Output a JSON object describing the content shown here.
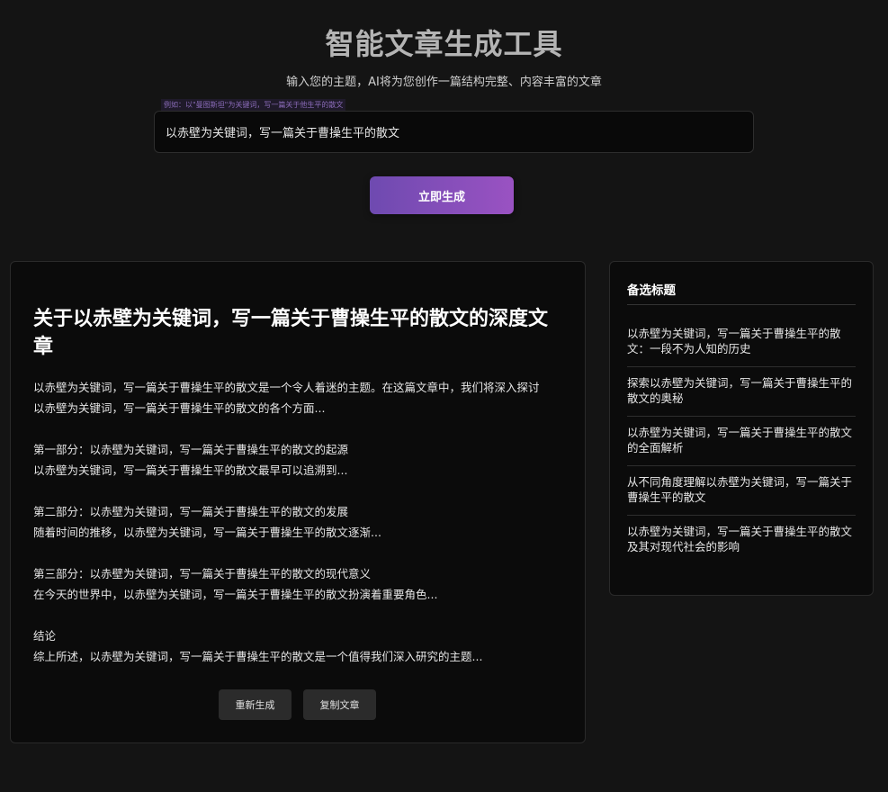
{
  "header": {
    "title": "智能文章生成工具",
    "subtitle": "输入您的主题，AI将为您创作一篇结构完整、内容丰富的文章"
  },
  "form": {
    "hint": "例如：以\"曼图斯坦\"为关键词，写一篇关于他生平的散文",
    "input_value": "以赤壁为关键词，写一篇关于曹操生平的散文",
    "generate_label": "立即生成"
  },
  "article": {
    "title": "关于以赤壁为关键词，写一篇关于曹操生平的散文的深度文章",
    "paragraphs": [
      {
        "line1": "以赤壁为关键词，写一篇关于曹操生平的散文是一个令人着迷的主题。在这篇文章中，我们将深入探讨",
        "line2": "以赤壁为关键词，写一篇关于曹操生平的散文的各个方面..."
      },
      {
        "line1": "第一部分：以赤壁为关键词，写一篇关于曹操生平的散文的起源",
        "line2": "以赤壁为关键词，写一篇关于曹操生平的散文最早可以追溯到..."
      },
      {
        "line1": "第二部分：以赤壁为关键词，写一篇关于曹操生平的散文的发展",
        "line2": "随着时间的推移，以赤壁为关键词，写一篇关于曹操生平的散文逐渐..."
      },
      {
        "line1": "第三部分：以赤壁为关键词，写一篇关于曹操生平的散文的现代意义",
        "line2": "在今天的世界中，以赤壁为关键词，写一篇关于曹操生平的散文扮演着重要角色..."
      },
      {
        "line1": "结论",
        "line2": "综上所述，以赤壁为关键词，写一篇关于曹操生平的散文是一个值得我们深入研究的主题..."
      }
    ],
    "regenerate_label": "重新生成",
    "copy_label": "复制文章"
  },
  "alternatives": {
    "heading": "备选标题",
    "items": [
      "以赤壁为关键词，写一篇关于曹操生平的散文：一段不为人知的历史",
      "探索以赤壁为关键词，写一篇关于曹操生平的散文的奥秘",
      "以赤壁为关键词，写一篇关于曹操生平的散文的全面解析",
      "从不同角度理解以赤壁为关键词，写一篇关于曹操生平的散文",
      "以赤壁为关键词，写一篇关于曹操生平的散文及其对现代社会的影响"
    ]
  },
  "colors": {
    "background": "#141414",
    "card": "#0b0b0b",
    "accent_start": "#6e4ab0",
    "accent_end": "#9a52c2"
  }
}
